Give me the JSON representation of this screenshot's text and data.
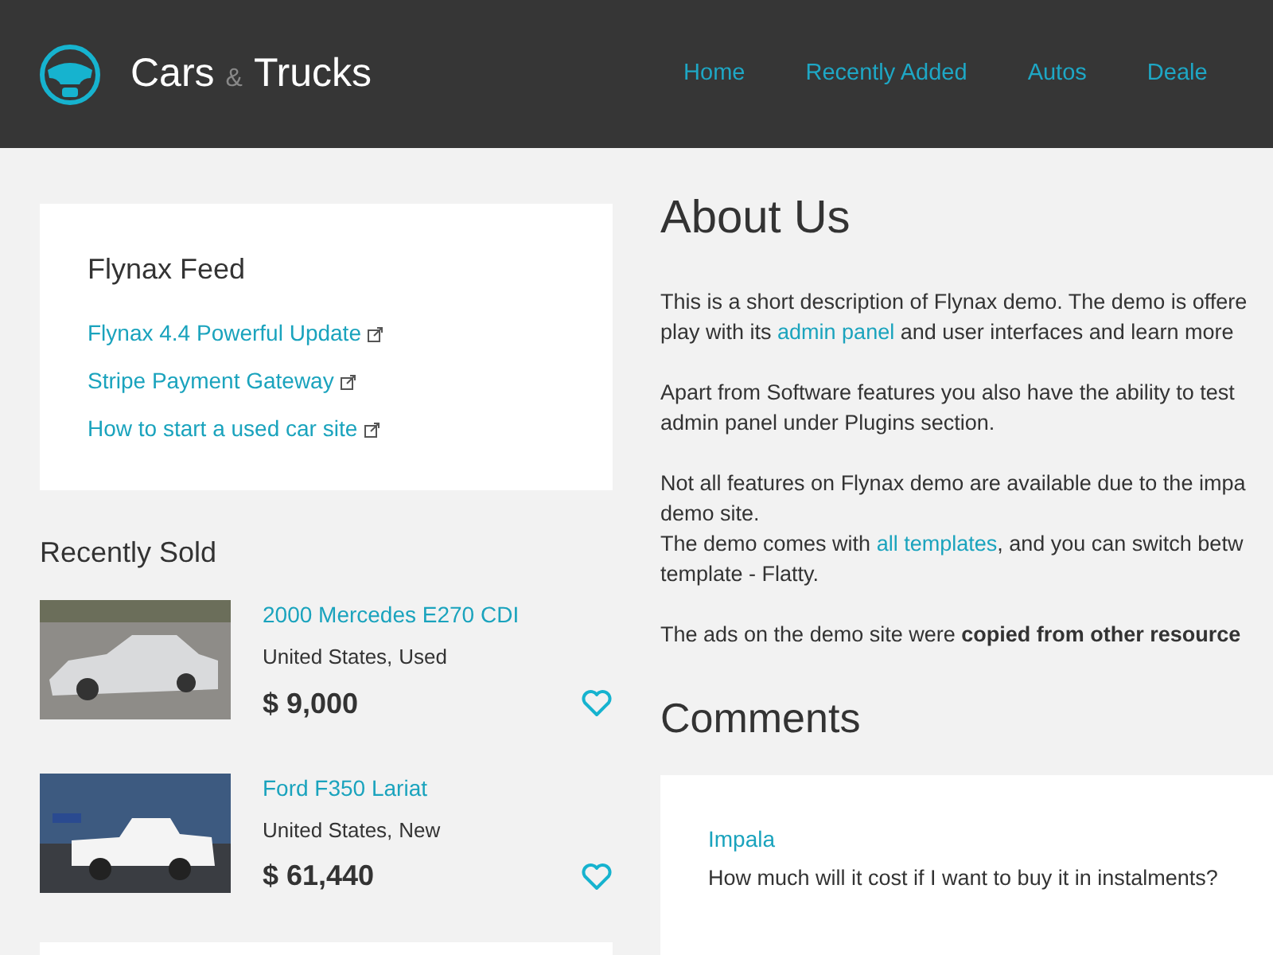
{
  "header": {
    "brand": {
      "first": "Cars",
      "amp": "&",
      "second": "Trucks"
    },
    "nav": [
      {
        "label": "Home"
      },
      {
        "label": "Recently Added"
      },
      {
        "label": "Autos"
      },
      {
        "label": "Deale"
      }
    ]
  },
  "feed": {
    "title": "Flynax Feed",
    "links": [
      "Flynax 4.4 Powerful Update",
      "Stripe Payment Gateway",
      "How to start a used car site"
    ]
  },
  "recently_sold": {
    "title": "Recently Sold",
    "items": [
      {
        "kind": "sedan",
        "title": "2000 Mercedes E270 CDI",
        "location": "United States,",
        "condition": "Used",
        "price": "$ 9,000"
      },
      {
        "kind": "truck",
        "title": "Ford F350 Lariat",
        "location": "United States,",
        "condition": "New",
        "price": "$ 61,440"
      }
    ]
  },
  "about": {
    "title": "About Us",
    "paragraphs": [
      [
        [
          {
            "kind": "text",
            "text": "This is a short description of Flynax demo. The demo is offere"
          }
        ],
        [
          {
            "kind": "text",
            "text": "play with its "
          },
          {
            "kind": "link",
            "text": "admin panel"
          },
          {
            "kind": "text",
            "text": " and user interfaces and learn more"
          }
        ]
      ],
      [
        [
          {
            "kind": "text",
            "text": "Apart from Software features you also have the ability to test"
          }
        ],
        [
          {
            "kind": "text",
            "text": "admin panel under Plugins section."
          }
        ]
      ],
      [
        [
          {
            "kind": "text",
            "text": "Not all features on Flynax demo are available due to the impa"
          }
        ],
        [
          {
            "kind": "text",
            "text": "demo site."
          }
        ],
        [
          {
            "kind": "text",
            "text": "The demo comes with "
          },
          {
            "kind": "link",
            "text": "all templates"
          },
          {
            "kind": "text",
            "text": ", and you can switch betw"
          }
        ],
        [
          {
            "kind": "text",
            "text": "template - Flatty."
          }
        ]
      ],
      [
        [
          {
            "kind": "text",
            "text": "The ads on the demo site were "
          },
          {
            "kind": "bold",
            "text": "copied from other resource"
          }
        ]
      ]
    ]
  },
  "comments": {
    "title": "Comments",
    "items": [
      {
        "author": "Impala",
        "text": "How much will it cost if I want to buy it in instalments?"
      }
    ]
  }
}
